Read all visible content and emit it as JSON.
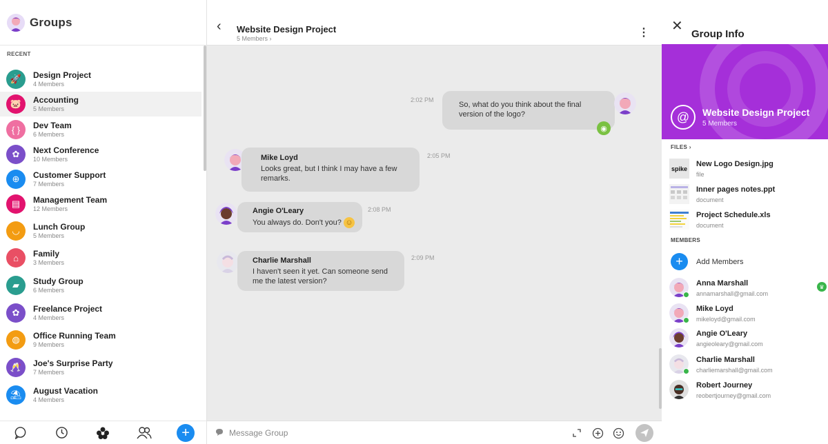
{
  "left": {
    "title": "Groups",
    "section_label": "RECENT",
    "groups": [
      {
        "name": "Design Project",
        "members": "4 Members",
        "color": "#2a9d8f",
        "icon": "rocket-icon",
        "glyph": "🚀"
      },
      {
        "name": "Accounting",
        "members": "5 Members",
        "color": "#e2136e",
        "icon": "piggy-bank-icon",
        "glyph": "🐷"
      },
      {
        "name": "Dev Team",
        "members": "6 Members",
        "color": "#ef6fa1",
        "icon": "code-braces-icon",
        "glyph": "{ }"
      },
      {
        "name": "Next Conference",
        "members": "10 Members",
        "color": "#7b4fc9",
        "icon": "group-dots-icon",
        "glyph": "✿"
      },
      {
        "name": "Customer Support",
        "members": "7 Members",
        "color": "#1a8cf0",
        "icon": "lifebuoy-icon",
        "glyph": "⊕"
      },
      {
        "name": "Management Team",
        "members": "12 Members",
        "color": "#e2136e",
        "icon": "clipboard-icon",
        "glyph": "▤"
      },
      {
        "name": "Lunch Group",
        "members": "5 Members",
        "color": "#f39c12",
        "icon": "bowl-icon",
        "glyph": "◡"
      },
      {
        "name": "Family",
        "members": "3 Members",
        "color": "#e94f64",
        "icon": "home-icon",
        "glyph": "⌂"
      },
      {
        "name": "Study Group",
        "members": "6 Members",
        "color": "#2a9d8f",
        "icon": "book-icon",
        "glyph": "▰"
      },
      {
        "name": "Freelance Project",
        "members": "4 Members",
        "color": "#7b4fc9",
        "icon": "group-dots-icon",
        "glyph": "✿"
      },
      {
        "name": "Office Running Team",
        "members": "9 Members",
        "color": "#f39c12",
        "icon": "basketball-icon",
        "glyph": "◍"
      },
      {
        "name": "Joe's Surprise Party",
        "members": "7 Members",
        "color": "#7b4fc9",
        "icon": "party-glasses-icon",
        "glyph": "🥂"
      },
      {
        "name": "August Vacation",
        "members": "4 Members",
        "color": "#1a8cf0",
        "icon": "beach-icon",
        "glyph": "⛱"
      }
    ],
    "footer": {
      "chat_icon": "chat-bubble-icon",
      "clock_icon": "clock-icon",
      "groups_icon": "groups-icon",
      "contacts_icon": "contacts-icon",
      "add_icon": "plus-icon"
    }
  },
  "chat": {
    "title": "Website Design Project",
    "subtitle": "5 Members ›",
    "messages": [
      {
        "sender": "",
        "text": "So, what do you think about the final version of the logo?",
        "time": "2:02 PM",
        "outgoing": true
      },
      {
        "sender": "Mike Loyd",
        "text": "Looks great, but I think I may have a few remarks.",
        "time": "2:05 PM"
      },
      {
        "sender": "Angie O'Leary",
        "text": "You always do. Don't you?",
        "time": "2:08 PM",
        "emoji": "☺"
      },
      {
        "sender": "Charlie Marshall",
        "text": "I haven't seen it yet. Can someone send me the latest version?",
        "time": "2:09 PM"
      }
    ],
    "composer": {
      "placeholder": "Message Group"
    }
  },
  "info": {
    "title": "Group Info",
    "banner_title": "Website Design Project",
    "banner_sub": "5 Members",
    "files_label": "FILES ›",
    "files": [
      {
        "name": "New Logo Design.jpg",
        "type": "file",
        "thumb_text": "spike"
      },
      {
        "name": "Inner pages notes.ppt",
        "type": "document",
        "thumb_text": ""
      },
      {
        "name": "Project Schedule.xls",
        "type": "document",
        "thumb_text": ""
      }
    ],
    "members_label": "MEMBERS",
    "add_members_label": "Add Members",
    "members": [
      {
        "name": "Anna Marshall",
        "email": "annamarshall@gmail.com",
        "online": true,
        "admin": true
      },
      {
        "name": "Mike Loyd",
        "email": "mikeloyd@gmail.com",
        "online": true,
        "admin": false
      },
      {
        "name": "Angie O'Leary",
        "email": "angieoleary@gmail.com",
        "online": false,
        "admin": false
      },
      {
        "name": "Charlie Marshall",
        "email": "charliemarshall@gmail.com",
        "online": true,
        "admin": false
      },
      {
        "name": "Robert Journey",
        "email": "reobertjourney@gmail.com",
        "online": false,
        "admin": false
      }
    ]
  },
  "colors": {
    "accent_blue": "#1a8cf0",
    "banner_purple": "#a52fd9",
    "online_green": "#39b54a",
    "bubble_gray": "#d8d8d8"
  }
}
